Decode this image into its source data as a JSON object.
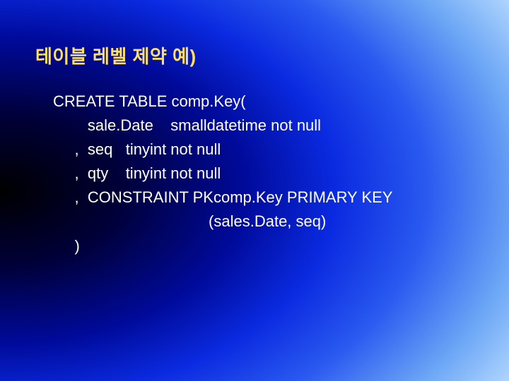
{
  "title": "테이블 레벨 제약 예)",
  "code": {
    "l1": "CREATE TABLE comp.Key(",
    "l2": "        sale.Date    smalldatetime not null",
    "l3": "     ,  seq   tinyint not null",
    "l4": "     ,  qty    tinyint not null",
    "l5": "     ,  CONSTRAINT PKcomp.Key PRIMARY KEY",
    "l6": "                                    (sales.Date, seq)",
    "l7": "     )"
  }
}
